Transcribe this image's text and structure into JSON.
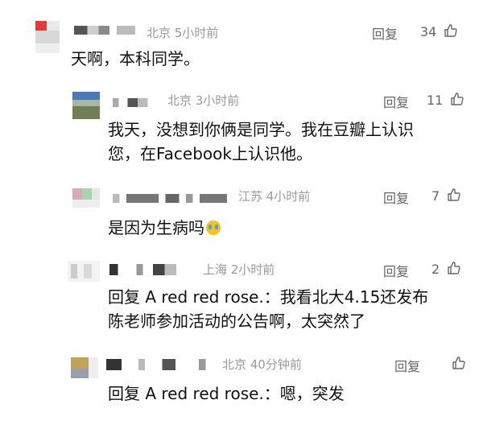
{
  "comments": [
    {
      "location_time": "北京 5小时前",
      "reply_label": "回复",
      "likes": "34",
      "text": "天啊，本科同学。"
    },
    {
      "location_time": "北京 3小时前",
      "reply_label": "回复",
      "likes": "11",
      "text_line1": "我天，没想到你俩是同学。我在豆瓣上认识",
      "text_line2": "您，在Facebook上认识他。"
    },
    {
      "location_time": "江苏 4小时前",
      "reply_label": "回复",
      "likes": "7",
      "text": "是因为生病吗",
      "emoji": "crying-face"
    },
    {
      "location_time": "上海 2小时前",
      "reply_label": "回复",
      "likes": "2",
      "text_line1": "回复 A red red rose.：我看北大4.15还发布",
      "text_line2": "陈老师参加活动的公告啊，太突然了"
    },
    {
      "location_time": "北京 40分钟前",
      "reply_label": "回复",
      "likes": "",
      "text": "回复 A red red rose.：嗯，突发"
    }
  ],
  "icons": {
    "like": "thumbs-up-icon"
  },
  "colors": {
    "meta": "#9a9a9a",
    "text": "#111111",
    "action": "#666666"
  }
}
